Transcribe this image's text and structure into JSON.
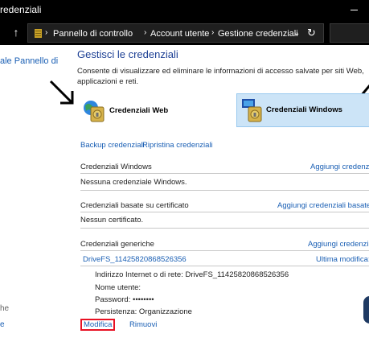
{
  "window": {
    "title": "redenziali"
  },
  "address": {
    "crumbs": [
      "Pannello di controllo",
      "Account utente",
      "Gestione credenziali"
    ]
  },
  "sidebar": {
    "home_link": "ale Pannello di",
    "see_also": "he",
    "link2": "e"
  },
  "main": {
    "title": "Gestisci le credenziali",
    "description": "Consente di visualizzare ed eliminare le informazioni di accesso salvate per siti Web, applicazioni e reti.",
    "web_credentials_label": "Credenziali Web",
    "windows_credentials_label": "Credenziali Windows",
    "backup_link": "Backup credenziali",
    "restore_link": "Ripristina credenziali",
    "sections": {
      "windows": {
        "title": "Credenziali Windows",
        "add": "Aggiungi credenzia",
        "empty": "Nessuna credenziale Windows."
      },
      "certificate": {
        "title": "Credenziali basate su certificato",
        "add": "Aggiungi credenziali basate s",
        "empty": "Nessun certificato."
      },
      "generic": {
        "title": "Credenziali generiche",
        "add": "Aggiungi credenzia"
      }
    },
    "credential": {
      "name": "DriveFS_11425820868526356",
      "modified": "Ultima modifica:",
      "details": [
        {
          "label": "Indirizzo Internet o di rete:",
          "value": "DriveFS_11425820868526356"
        },
        {
          "label": "Nome utente:",
          "value": ""
        },
        {
          "label": "Password:",
          "value": "••••••••"
        },
        {
          "label": "Persistenza:",
          "value": "Organizzazione"
        }
      ],
      "edit": "Modifica",
      "remove": "Rimuovi"
    }
  },
  "icons": {
    "up": "up-arrow-icon",
    "folder": "folder-icon",
    "refresh": "refresh-icon",
    "web_cred": "web-credentials-icon",
    "win_cred": "windows-credentials-icon"
  },
  "colors": {
    "link": "#1a5fb4",
    "title": "#1c3f94",
    "selected_bg": "#cce4f7",
    "highlight_border": "#e81123"
  }
}
